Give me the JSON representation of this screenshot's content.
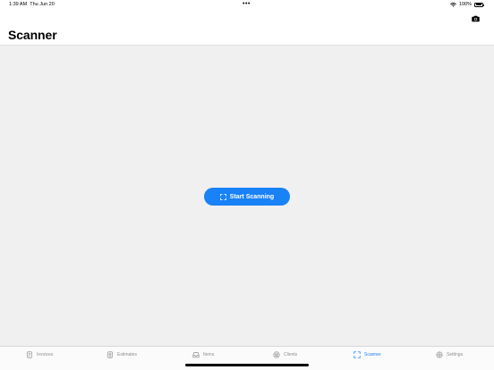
{
  "status_bar": {
    "time": "1:39 AM",
    "date": "Thu Jun 20",
    "multitask": "•••",
    "battery_text": "100%",
    "wifi_icon": "wifi-icon",
    "battery_icon": "battery-icon"
  },
  "header": {
    "title": "Scanner",
    "camera_icon": "camera-icon"
  },
  "main": {
    "scan_button_label": "Start Scanning",
    "scan_icon": "scan-frame-icon"
  },
  "tabs": [
    {
      "label": "Invoices",
      "icon": "document-icon",
      "active": false
    },
    {
      "label": "Estimates",
      "icon": "estimate-icon",
      "active": false
    },
    {
      "label": "Items",
      "icon": "inbox-tray-icon",
      "active": false
    },
    {
      "label": "Clients",
      "icon": "clients-icon",
      "active": false
    },
    {
      "label": "Scanner",
      "icon": "scan-frame-icon",
      "active": true
    },
    {
      "label": "Settings",
      "icon": "gear-icon",
      "active": false
    }
  ],
  "colors": {
    "accent": "#1a82f7",
    "background": "#f0f0f1",
    "inactive_tab": "#8e8e93"
  }
}
